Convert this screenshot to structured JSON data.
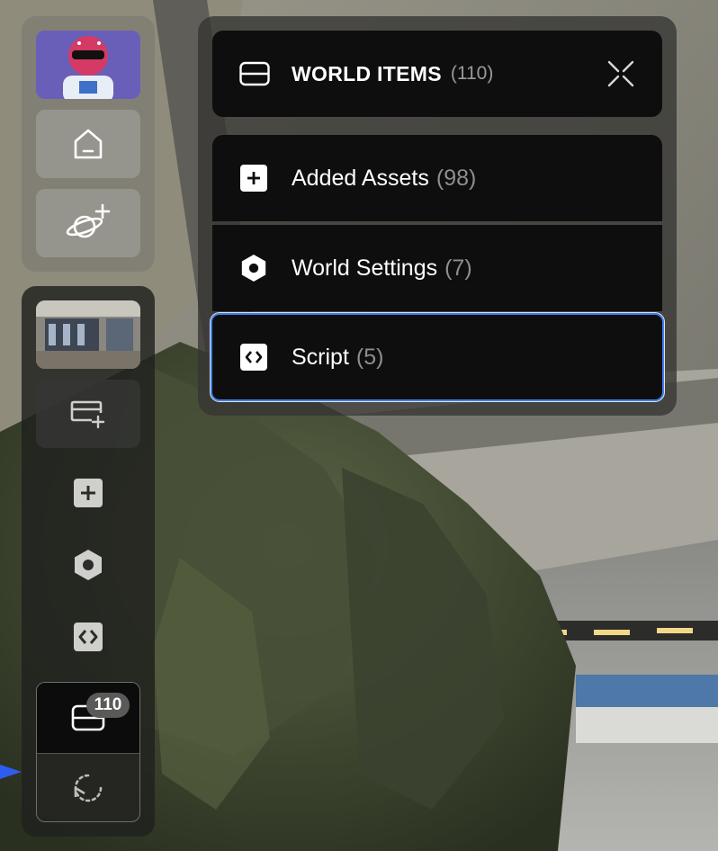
{
  "panel": {
    "title": "WORLD ITEMS",
    "count": "(110)",
    "header_icon": "panel-icon",
    "close_icon": "close-icon",
    "items": [
      {
        "label": "Added Assets",
        "count": "(98)",
        "icon": "plus-square-icon"
      },
      {
        "label": "World Settings",
        "count": "(7)",
        "icon": "hexagon-icon"
      },
      {
        "label": "Script",
        "count": "(5)",
        "icon": "code-icon",
        "selected": true
      }
    ]
  },
  "sidebar": {
    "top_buttons": [
      {
        "name": "avatar",
        "icon": "avatar"
      },
      {
        "name": "home",
        "icon": "home-icon"
      },
      {
        "name": "explore-worlds",
        "icon": "planet-plus-icon"
      }
    ],
    "build_buttons": [
      {
        "name": "world-thumbnail",
        "icon": "thumbnail"
      },
      {
        "name": "add-panel",
        "icon": "panel-add-icon"
      },
      {
        "name": "added-assets",
        "icon": "plus-square-icon"
      },
      {
        "name": "world-settings",
        "icon": "hexagon-icon"
      },
      {
        "name": "script",
        "icon": "code-icon"
      },
      {
        "name": "world-items",
        "icon": "panel-icon"
      },
      {
        "name": "history",
        "icon": "undo-history-icon"
      }
    ],
    "world_items_badge": "110"
  },
  "colors": {
    "panel_bg": "#0e0e0e",
    "selected_border": "#3d7ef0",
    "muted_text": "#8e8e8c"
  }
}
